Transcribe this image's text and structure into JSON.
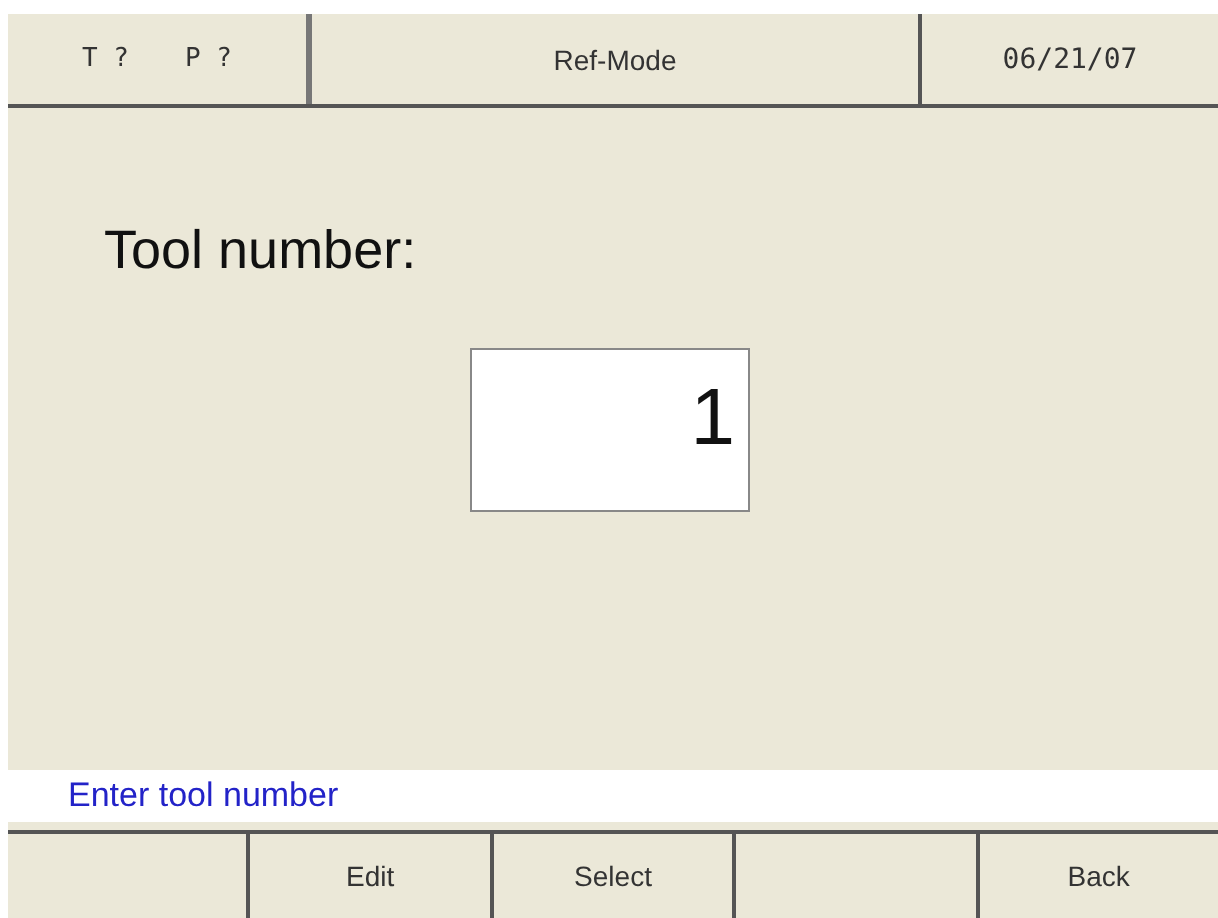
{
  "header": {
    "tool_indicator": "T ?",
    "position_indicator": "P ?",
    "mode": "Ref-Mode",
    "date": "06/21/07"
  },
  "prompt": {
    "label": "Tool number:",
    "value": "1"
  },
  "status_message": "Enter tool number",
  "softkeys": [
    {
      "label": "Edit",
      "empty_slot_before": true
    },
    {
      "label": "Select",
      "empty_slot_before": false
    },
    {
      "label": "Back",
      "empty_slot_before": true
    }
  ]
}
